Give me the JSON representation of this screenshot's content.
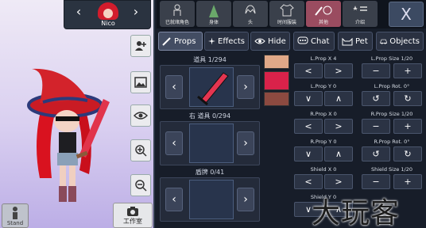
{
  "character": {
    "name": "Nico",
    "prev": "‹",
    "next": "›"
  },
  "categories": [
    {
      "label": "已就绪角色",
      "icon": "character-icon"
    },
    {
      "label": "身体",
      "icon": "body-icon"
    },
    {
      "label": "头",
      "icon": "hair-icon"
    },
    {
      "label": "时间服装",
      "icon": "shirt-icon"
    },
    {
      "label": "其他",
      "icon": "props-cat-icon"
    },
    {
      "label": "介绍",
      "icon": "profile-icon"
    }
  ],
  "close_label": "X",
  "tabs": {
    "props": "Props",
    "effects": "Effects",
    "hide": "Hide",
    "chat": "Chat",
    "pet": "Pet",
    "objects": "Objects"
  },
  "slots": [
    {
      "label": "道具 1/294",
      "prev": "‹",
      "next": "›"
    },
    {
      "label": "右 道具 0/294",
      "prev": "‹",
      "next": "›"
    },
    {
      "label": "盾牌 0/41",
      "prev": "‹",
      "next": "›"
    }
  ],
  "swatches": [
    "#e0a888",
    "#d9224a",
    "#8c4a40"
  ],
  "controls": [
    {
      "left": "L.Prop X 4",
      "right": "L.Prop Size 1/20",
      "l1": "<",
      "l2": ">",
      "r1": "−",
      "r2": "+"
    },
    {
      "left": "L.Prop Y 0",
      "right": "L.Prop Rot. 0°",
      "l1": "∨",
      "l2": "∧",
      "r1": "↺",
      "r2": "↻"
    },
    {
      "left": "R.Prop X 0",
      "right": "R.Prop Size 1/20",
      "l1": "<",
      "l2": ">",
      "r1": "−",
      "r2": "+"
    },
    {
      "left": "R.Prop Y 0",
      "right": "R.Prop Rot. 0°",
      "l1": "∨",
      "l2": "∧",
      "r1": "↺",
      "r2": "↻"
    },
    {
      "left": "Shield X 0",
      "right": "Shield Size 1/20",
      "l1": "<",
      "l2": ">",
      "r1": "−",
      "r2": "+"
    },
    {
      "left": "Shield Y 0",
      "right": "",
      "l1": "∨",
      "l2": "∧",
      "r1": "",
      "r2": ""
    }
  ],
  "stand_label": "Stand",
  "studio_label": "工作室",
  "watermark": "大玩客"
}
